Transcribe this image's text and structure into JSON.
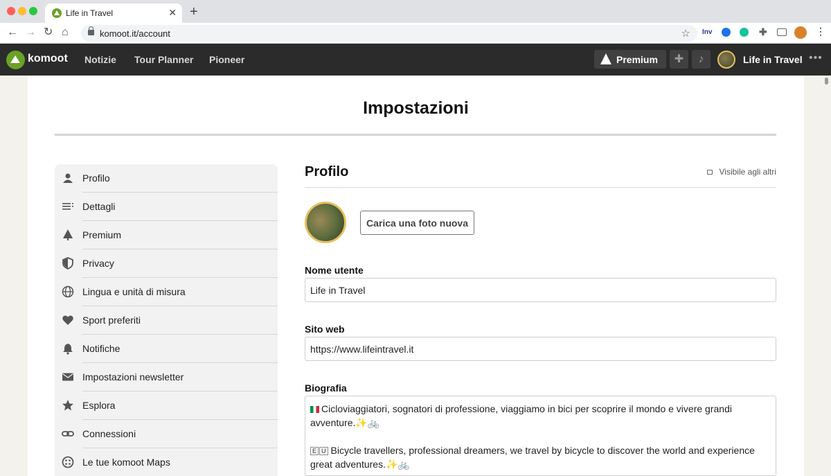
{
  "browser": {
    "tab_title": "Life in Travel",
    "tab_close": "✕",
    "new_tab": "+",
    "url": "komoot.it/account",
    "ext_inv": "Inv"
  },
  "nav": {
    "brand": "komoot",
    "links": [
      "Notizie",
      "Tour Planner",
      "Pioneer"
    ],
    "premium_label": "Premium",
    "user_name": "Life in Travel",
    "more": "•••"
  },
  "page": {
    "title": "Impostazioni"
  },
  "sidebar": {
    "items": [
      {
        "label": "Profilo",
        "icon": "person-icon"
      },
      {
        "label": "Dettagli",
        "icon": "list-icon"
      },
      {
        "label": "Premium",
        "icon": "tree-icon"
      },
      {
        "label": "Privacy",
        "icon": "shield-icon"
      },
      {
        "label": "Lingua e unità di misura",
        "icon": "globe-icon"
      },
      {
        "label": "Sport preferiti",
        "icon": "heart-icon"
      },
      {
        "label": "Notifiche",
        "icon": "bell-icon"
      },
      {
        "label": "Impostazioni newsletter",
        "icon": "envelope-icon"
      },
      {
        "label": "Esplora",
        "icon": "star-icon"
      },
      {
        "label": "Connessioni",
        "icon": "link-icon"
      },
      {
        "label": "Le tue komoot Maps",
        "icon": "maps-icon"
      }
    ]
  },
  "profile": {
    "section_title": "Profilo",
    "visibility": "Visibile agli altri",
    "upload_label": "Carica una foto nuova",
    "username_label": "Nome utente",
    "username_value": "Life in Travel",
    "website_label": "Sito web",
    "website_value": "https://www.lifeintravel.it",
    "bio_label": "Biografia",
    "bio_it": "Cicloviaggiatori, sognatori di professione, viaggiamo in bici per scoprire il mondo e vivere grandi avventure.✨🚲",
    "bio_en": "Bicycle travellers, professional dreamers, we travel by bicycle to discover the world and experience great adventures.✨🚲"
  },
  "colors": {
    "nav_bg": "#2b2b2b",
    "brand_green": "#6aa127",
    "avatar_ring": "#e8c061"
  }
}
